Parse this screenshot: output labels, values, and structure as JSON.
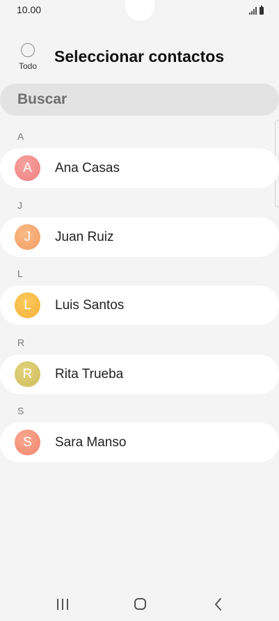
{
  "status_bar": {
    "time": "10.00"
  },
  "header": {
    "select_all_label": "Todo",
    "title": "Seleccionar contactos"
  },
  "search": {
    "placeholder": "Buscar"
  },
  "sections": [
    {
      "letter": "A",
      "contact": {
        "initial": "A",
        "name": "Ana Casas",
        "avatar_color": "#f08a8a"
      }
    },
    {
      "letter": "J",
      "contact": {
        "initial": "J",
        "name": "Juan Ruiz",
        "avatar_color": "#f6a86e"
      }
    },
    {
      "letter": "L",
      "contact": {
        "initial": "L",
        "name": "Luis Santos",
        "avatar_color": "#f7b840"
      }
    },
    {
      "letter": "R",
      "contact": {
        "initial": "R",
        "name": "Rita Trueba",
        "avatar_color": "#d6c467"
      }
    },
    {
      "letter": "S",
      "contact": {
        "initial": "S",
        "name": "Sara Manso",
        "avatar_color": "#f4927a"
      }
    }
  ],
  "nav": {
    "icons": [
      "recent-apps-icon",
      "home-icon",
      "back-icon"
    ]
  }
}
